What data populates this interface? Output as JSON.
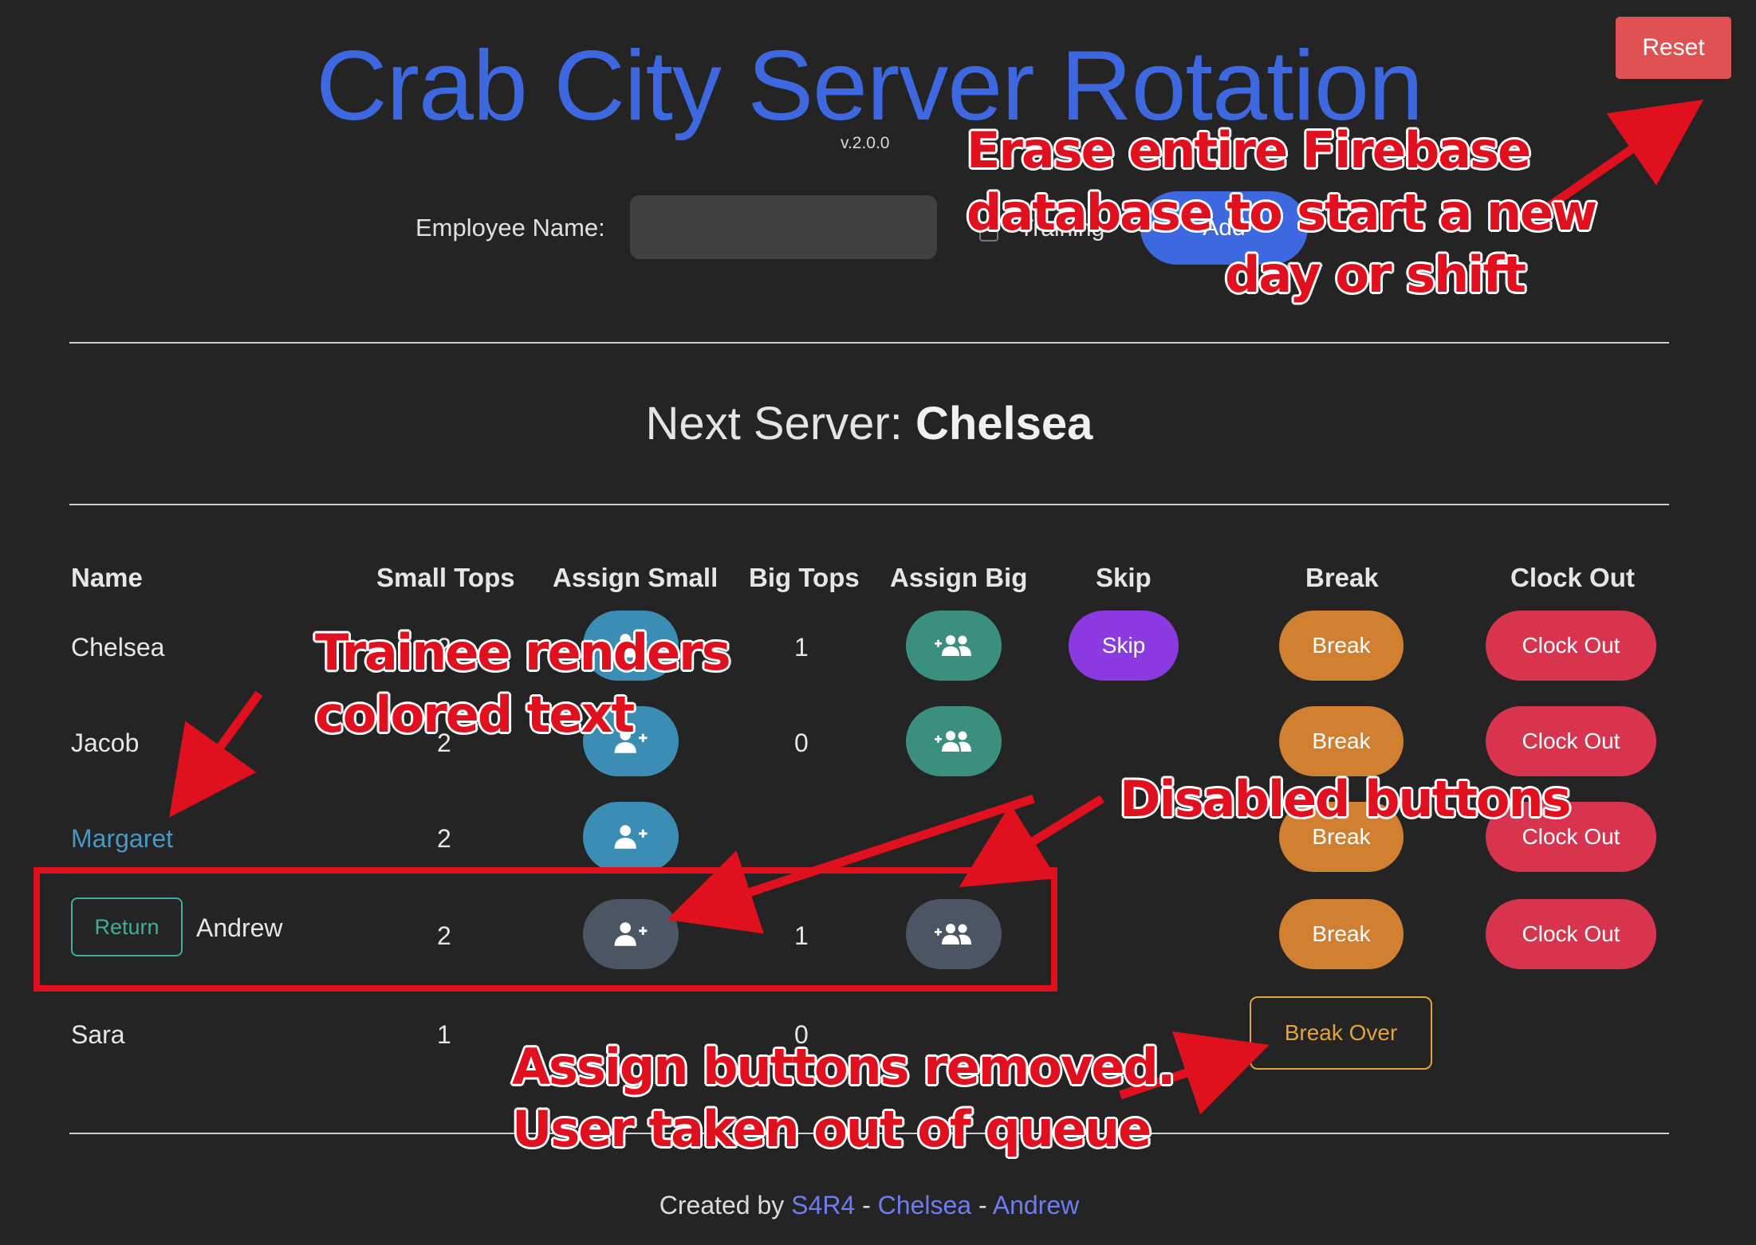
{
  "header": {
    "title": "Crab City Server Rotation",
    "version": "v.2.0.0",
    "reset_label": "Reset"
  },
  "form": {
    "employee_label": "Employee Name:",
    "employee_value": "",
    "training_label": "Training",
    "add_label": "Add"
  },
  "next_server": {
    "prefix": "Next Server: ",
    "name": "Chelsea"
  },
  "table": {
    "headers": [
      "Name",
      "Small Tops",
      "Assign Small",
      "Big Tops",
      "Assign Big",
      "Skip",
      "Break",
      "Clock Out"
    ],
    "rows": [
      {
        "name": "Chelsea",
        "small_tops": "2",
        "big_tops": "1",
        "skip": "Skip",
        "break": "Break",
        "clock_out": "Clock Out"
      },
      {
        "name": "Jacob",
        "small_tops": "2",
        "big_tops": "0",
        "break": "Break",
        "clock_out": "Clock Out"
      },
      {
        "name": "Margaret",
        "small_tops": "2",
        "big_tops": "",
        "break": "Break",
        "clock_out": "Clock Out",
        "trainee": true
      },
      {
        "name": "Andrew",
        "small_tops": "2",
        "big_tops": "1",
        "return": "Return",
        "break": "Break",
        "clock_out": "Clock Out",
        "disabled": true
      },
      {
        "name": "Sara",
        "small_tops": "1",
        "big_tops": "0",
        "break_over": "Break Over",
        "on_break": true
      }
    ]
  },
  "footer": {
    "prefix": "Created by ",
    "authors": [
      "S4R4",
      "Chelsea",
      "Andrew"
    ],
    "separator": " - "
  },
  "annotations": {
    "reset_note": [
      "Erase entire Firebase",
      "database to start a new",
      "day or shift"
    ],
    "trainee_note": [
      "Trainee renders",
      "colored text"
    ],
    "disabled_note": "Disabled buttons",
    "removed_note": [
      "Assign buttons removed.",
      "User taken out of queue"
    ]
  },
  "colors": {
    "title": "#3d68e0",
    "reset": "#e05252",
    "assign_small": "#3b8db3",
    "assign_big": "#3a8f7e",
    "disabled": "#4c5563",
    "skip": "#8a3ae0",
    "break": "#d08030",
    "clock_out": "#d8344e",
    "trainee_text": "#4a97c0",
    "annotation": "#e0101e"
  },
  "icons": {
    "assign_small": "person-plus-icon",
    "assign_big": "people-plus-icon"
  }
}
